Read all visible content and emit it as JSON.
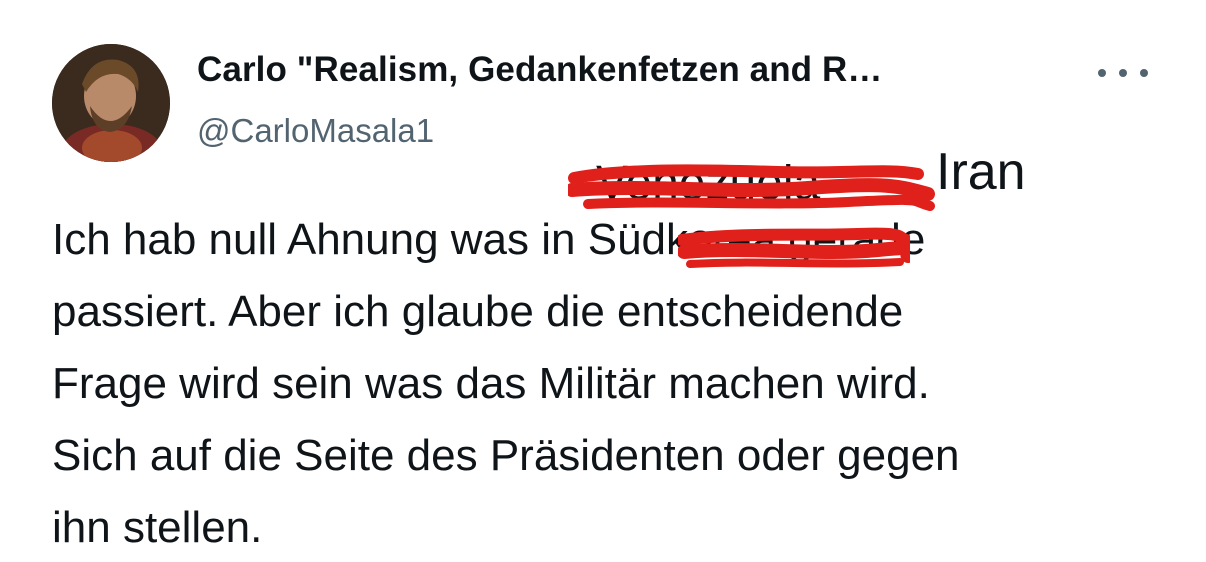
{
  "author": {
    "display_name": "Carlo \"Realism, Gedankenfetzen and R…",
    "handle": "@CarloMasala1",
    "avatar_icon": "portrait-avatar"
  },
  "more_icon": "more-horizontal-icon",
  "annotation": {
    "struck_word_1": "Venezuela",
    "replacement_word": "Iran",
    "struck_word_2": "Südkorea",
    "scribble_color": "#e0201b"
  },
  "tweet": {
    "line_1_before": "Ich hab null Ahnung was in ",
    "line_1_after": " gerade",
    "line_2": "passiert. Aber ich glaube die entscheidende",
    "line_3": "Frage wird sein was das Militär machen wird.",
    "line_4": "Sich auf die Seite des Präsidenten oder gegen",
    "line_5": "ihn stellen."
  }
}
